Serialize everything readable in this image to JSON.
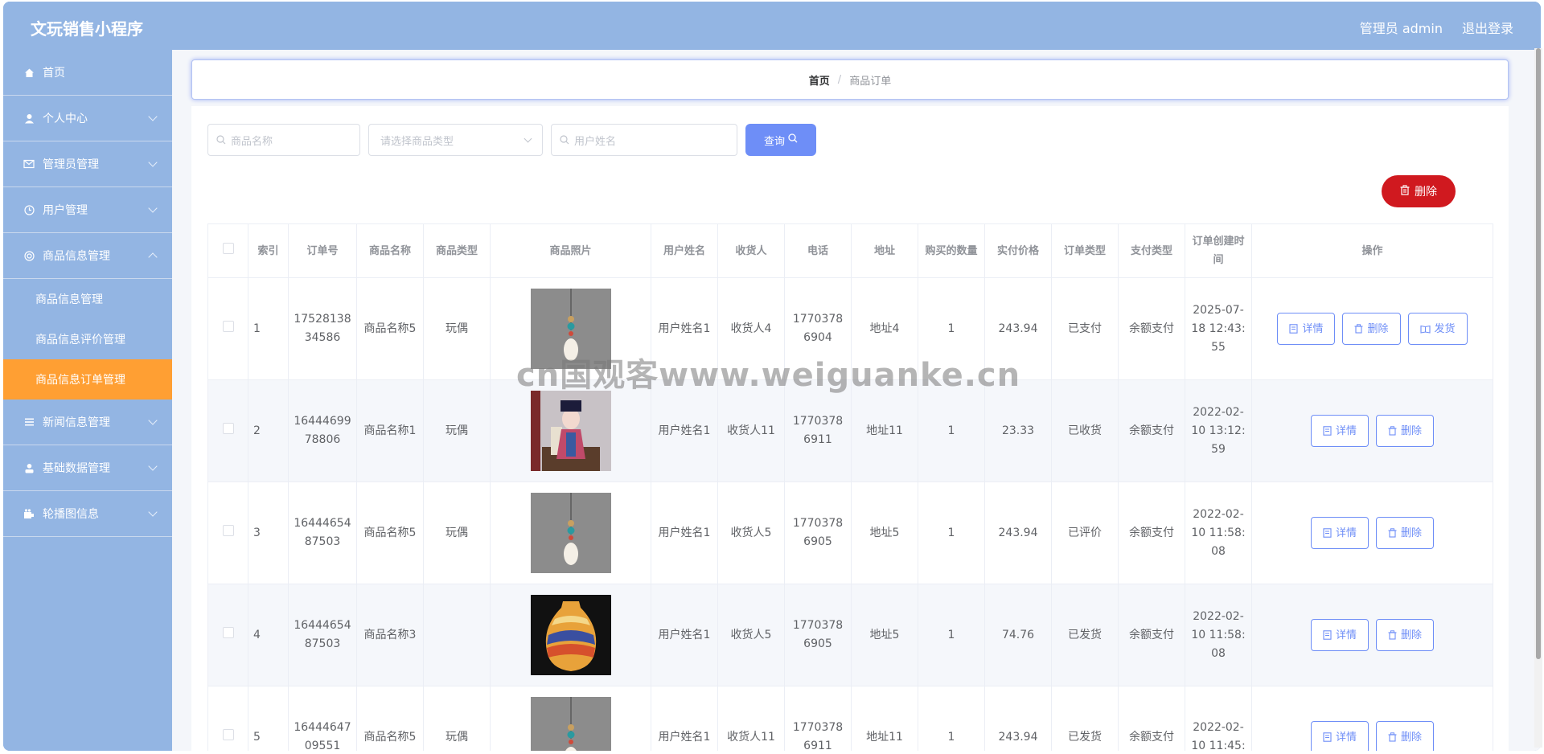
{
  "header": {
    "title": "文玩销售小程序",
    "admin_label": "管理员 admin",
    "logout_label": "退出登录"
  },
  "sidebar": {
    "items": [
      {
        "label": "首页",
        "icon": "home-icon"
      },
      {
        "label": "个人中心",
        "icon": "user-icon"
      },
      {
        "label": "管理员管理",
        "icon": "mail-icon"
      },
      {
        "label": "用户管理",
        "icon": "clock-icon"
      },
      {
        "label": "商品信息管理",
        "icon": "lifebuoy-icon"
      },
      {
        "label": "新闻信息管理",
        "icon": "menu-icon"
      },
      {
        "label": "基础数据管理",
        "icon": "person-icon"
      },
      {
        "label": "轮播图信息",
        "icon": "camera-icon"
      }
    ],
    "sub_items": [
      "商品信息管理",
      "商品信息评价管理",
      "商品信息订单管理"
    ],
    "active_sub": "商品信息订单管理",
    "active_color": "#ff9f33"
  },
  "breadcrumb": {
    "home": "首页",
    "separator": "/",
    "current": "商品订单"
  },
  "search": {
    "name_placeholder": "商品名称",
    "type_placeholder": "请选择商品类型",
    "user_placeholder": "用户姓名",
    "query_label": "查询"
  },
  "toolbar": {
    "delete_label": "删除"
  },
  "table": {
    "headers": [
      "索引",
      "订单号",
      "商品名称",
      "商品类型",
      "商品照片",
      "用户姓名",
      "收货人",
      "电话",
      "地址",
      "购买的数量",
      "实付价格",
      "订单类型",
      "支付类型",
      "订单创建时间",
      "操作"
    ],
    "rows": [
      {
        "idx": "1",
        "order_no": "1752813834586",
        "name": "商品名称5",
        "type": "玩偶",
        "photo": "gourd-pendant",
        "user": "用户姓名1",
        "receiver": "收货人4",
        "phone": "17703786904",
        "address": "地址4",
        "qty": "1",
        "price": "243.94",
        "order_type": "已支付",
        "pay_type": "余额支付",
        "created": "2025-07-18 12:43:55",
        "ops": [
          "详情",
          "删除",
          "发货"
        ]
      },
      {
        "idx": "2",
        "order_no": "1644469978806",
        "name": "商品名称1",
        "type": "玩偶",
        "photo": "doll-figure",
        "user": "用户姓名1",
        "receiver": "收货人11",
        "phone": "17703786911",
        "address": "地址11",
        "qty": "1",
        "price": "23.33",
        "order_type": "已收货",
        "pay_type": "余额支付",
        "created": "2022-02-10 13:12:59",
        "ops": [
          "详情",
          "删除"
        ]
      },
      {
        "idx": "3",
        "order_no": "1644465487503",
        "name": "商品名称5",
        "type": "玩偶",
        "photo": "gourd-pendant",
        "user": "用户姓名1",
        "receiver": "收货人5",
        "phone": "17703786905",
        "address": "地址5",
        "qty": "1",
        "price": "243.94",
        "order_type": "已评价",
        "pay_type": "余额支付",
        "created": "2022-02-10 11:58:08",
        "ops": [
          "详情",
          "删除"
        ]
      },
      {
        "idx": "4",
        "order_no": "1644465487503",
        "name": "商品名称3",
        "type": "",
        "photo": "painted-vase",
        "user": "用户姓名1",
        "receiver": "收货人5",
        "phone": "17703786905",
        "address": "地址5",
        "qty": "1",
        "price": "74.76",
        "order_type": "已发货",
        "pay_type": "余额支付",
        "created": "2022-02-10 11:58:08",
        "ops": [
          "详情",
          "删除"
        ]
      },
      {
        "idx": "5",
        "order_no": "1644464709551",
        "name": "商品名称5",
        "type": "玩偶",
        "photo": "gourd-pendant",
        "user": "用户姓名1",
        "receiver": "收货人11",
        "phone": "17703786911",
        "address": "地址11",
        "qty": "1",
        "price": "243.94",
        "order_type": "已发货",
        "pay_type": "余额支付",
        "created": "2022-02-10 11:45:",
        "ops": [
          "详情",
          "删除"
        ]
      }
    ]
  },
  "watermark": "cn国观客www.weiguanke.cn"
}
